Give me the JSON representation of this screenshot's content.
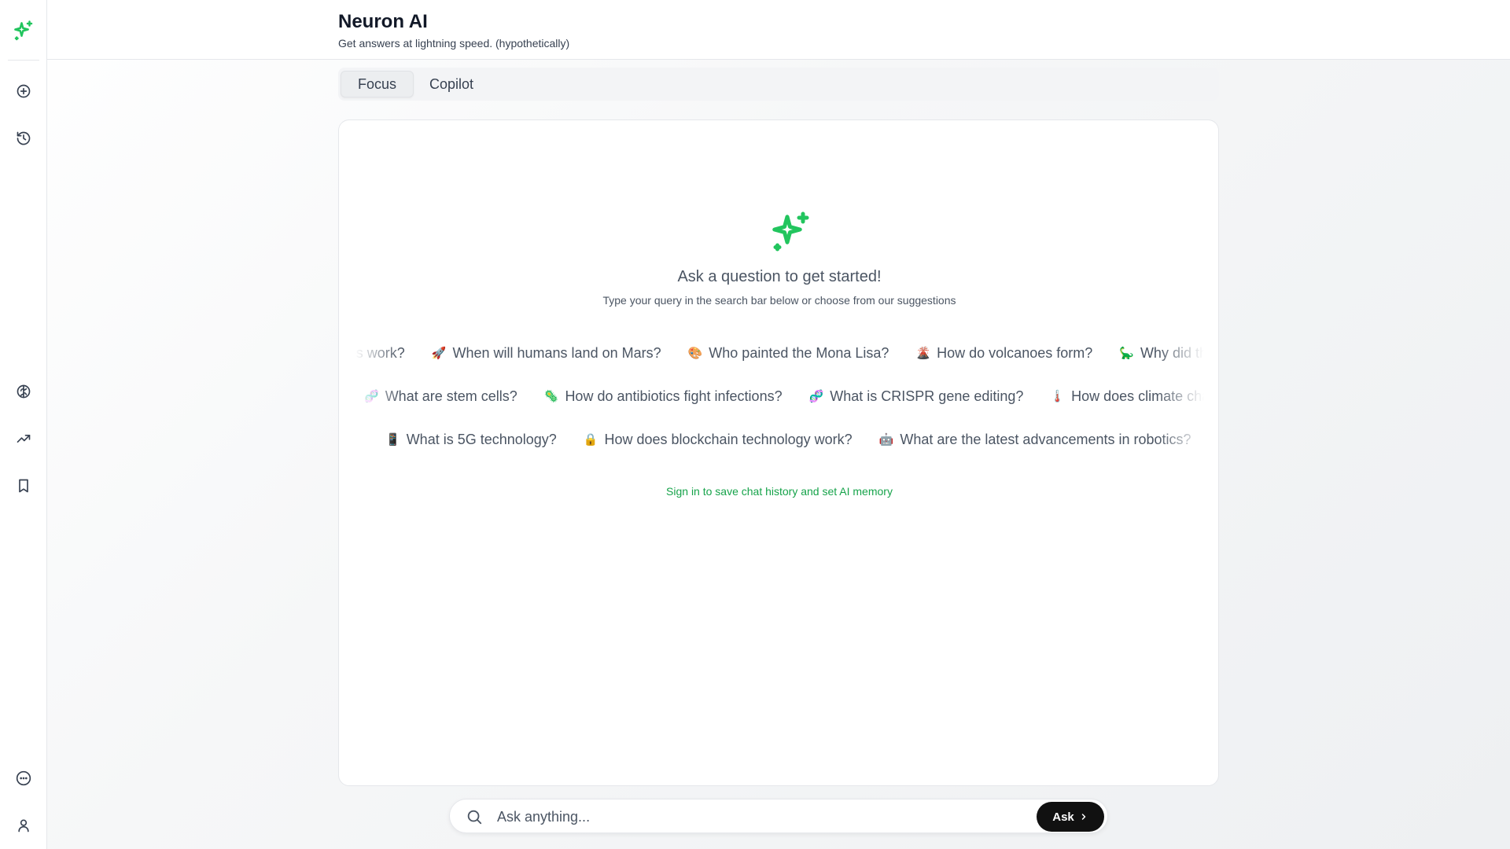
{
  "app": {
    "title": "Neuron AI",
    "subtitle": "Get answers at lightning speed. (hypothetically)",
    "accent_color": "#22c55e"
  },
  "sidebar": {
    "logo_icon": "sparkles-icon",
    "top_items": [
      {
        "icon": "plus-circle-icon",
        "name": "new-chat"
      },
      {
        "icon": "history-icon",
        "name": "history"
      }
    ],
    "middle_items": [
      {
        "icon": "brain-icon",
        "name": "explore"
      },
      {
        "icon": "trending-up-icon",
        "name": "trending"
      },
      {
        "icon": "bookmark-icon",
        "name": "bookmarks"
      }
    ],
    "bottom_items": [
      {
        "icon": "more-horizontal-circle-icon",
        "name": "more"
      },
      {
        "icon": "user-icon",
        "name": "account"
      }
    ]
  },
  "tabs": [
    {
      "label": "Focus",
      "active": true
    },
    {
      "label": "Copilot",
      "active": false
    }
  ],
  "hero": {
    "icon": "sparkles-icon",
    "title": "Ask a question to get started!",
    "subtitle": "Type your query in the search bar below or choose from our suggestions"
  },
  "suggestions": {
    "row1": [
      {
        "emoji": "💨",
        "text": "How do wind turbines work?"
      },
      {
        "emoji": "🚀",
        "text": "When will humans land on Mars?"
      },
      {
        "emoji": "🎨",
        "text": "Who painted the Mona Lisa?"
      },
      {
        "emoji": "🌋",
        "text": "How do volcanoes form?"
      },
      {
        "emoji": "🦕",
        "text": "Why did the dinosaurs go extinct?"
      }
    ],
    "row2": [
      {
        "emoji": "🧬",
        "text": "What are stem cells?"
      },
      {
        "emoji": "🦠",
        "text": "How do antibiotics fight infections?"
      },
      {
        "emoji": "🧬",
        "text": "What is CRISPR gene editing?"
      },
      {
        "emoji": "🌡️",
        "text": "How does climate change affect us?"
      }
    ],
    "row3": [
      {
        "emoji": "📱",
        "text": "What is 5G technology?"
      },
      {
        "emoji": "🔒",
        "text": "How does blockchain technology work?"
      },
      {
        "emoji": "🤖",
        "text": "What are the latest advancements in robotics?"
      }
    ]
  },
  "signin_text": "Sign in to save chat history and set AI memory",
  "search": {
    "placeholder": "Ask anything...",
    "value": "",
    "button_label": "Ask"
  }
}
